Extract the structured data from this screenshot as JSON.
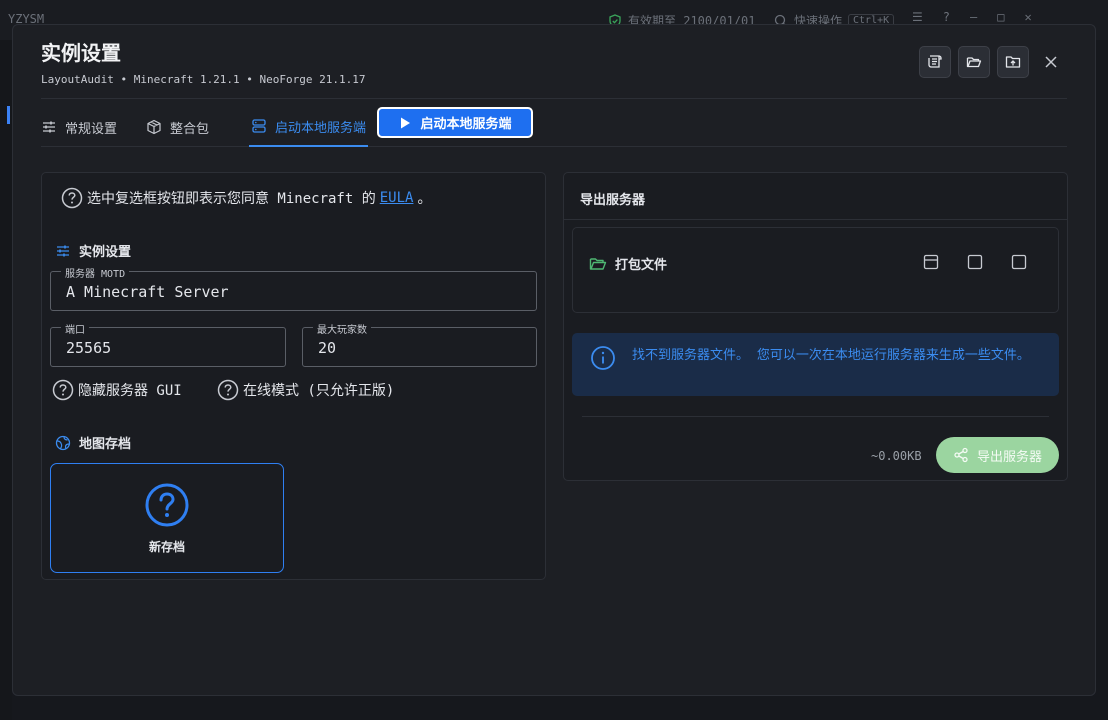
{
  "background": {
    "app_title": "YZYSM",
    "expiry_label": "有效期至 2100/01/01",
    "search_label": "快速操作",
    "search_shortcut": "Ctrl+K"
  },
  "dialog": {
    "title": "实例设置",
    "subtitle": "LayoutAudit • Minecraft 1.21.1 • NeoForge 21.1.17"
  },
  "tabs": [
    {
      "label": "常规设置",
      "icon": "sliders-icon",
      "active": false
    },
    {
      "label": "整合包",
      "icon": "package-icon",
      "active": false
    },
    {
      "label": "启动本地服务端",
      "icon": "server-icon",
      "active": true
    }
  ],
  "launch_button": {
    "label": "启动本地服务端"
  },
  "left_panel": {
    "eula_text": "选中复选框按钮即表示您同意 Minecraft 的 ",
    "eula_link": "EULA",
    "eula_end": "。",
    "instance_section": "实例设置",
    "motd": {
      "label": "服务器 MOTD",
      "value": "A Minecraft Server"
    },
    "port": {
      "label": "端口",
      "value": "25565"
    },
    "max_players": {
      "label": "最大玩家数",
      "value": "20"
    },
    "hide_gui_label": "隐藏服务器 GUI",
    "online_mode_label": "在线模式 (只允许正版)",
    "world_section": "地图存档",
    "new_world_label": "新存档"
  },
  "right_panel": {
    "title": "导出服务器",
    "pack_title": "打包文件",
    "info_text": "找不到服务器文件。 您可以一次在本地运行服务器来生成一些文件。",
    "size": "~0.00KB",
    "export_label": "导出服务器"
  },
  "colors": {
    "accent": "#3b8cf0",
    "export_button": "#9bd5a0",
    "info_bg": "#1a2c48"
  }
}
